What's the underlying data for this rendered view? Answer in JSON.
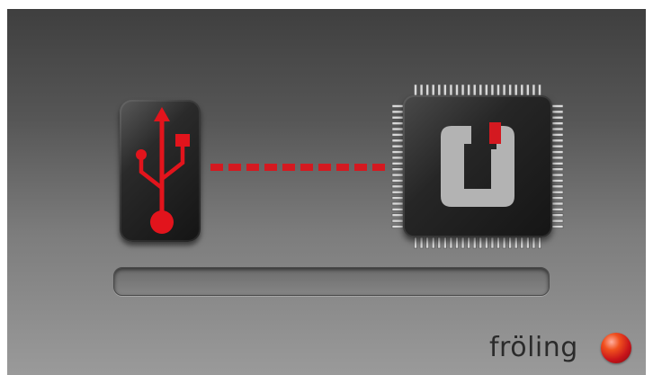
{
  "brand": {
    "logo_text": "fröling",
    "accent_color": "#d41920"
  },
  "transfer": {
    "source_icon": "usb-icon",
    "target_icon": "microcontroller-chip-icon",
    "link_style": "dashed-red"
  },
  "progress": {
    "value": 0
  }
}
